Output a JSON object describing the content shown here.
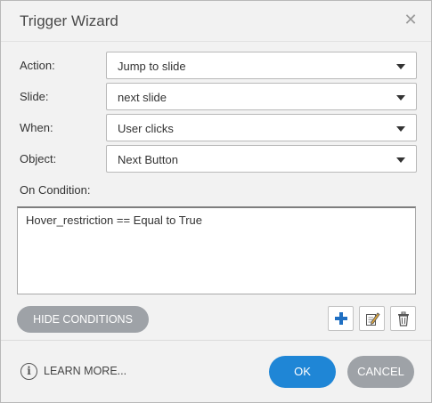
{
  "dialog": {
    "title": "Trigger Wizard",
    "close_icon": "close-icon"
  },
  "form": {
    "action_label": "Action:",
    "action_value": "Jump to slide",
    "slide_label": "Slide:",
    "slide_value": "next slide",
    "when_label": "When:",
    "when_value": "User clicks",
    "object_label": "Object:",
    "object_value": "Next Button",
    "on_condition_label": "On Condition:"
  },
  "conditions": {
    "items": [
      "Hover_restriction == Equal to True"
    ],
    "hide_button": "HIDE CONDITIONS",
    "tools": [
      "add-icon",
      "edit-icon",
      "delete-icon"
    ]
  },
  "footer": {
    "learn_more": "LEARN MORE...",
    "ok": "OK",
    "cancel": "CANCEL"
  },
  "colors": {
    "accent": "#1f86d6",
    "secondary_button": "#9ea2a7",
    "background": "#f2f2f2"
  }
}
